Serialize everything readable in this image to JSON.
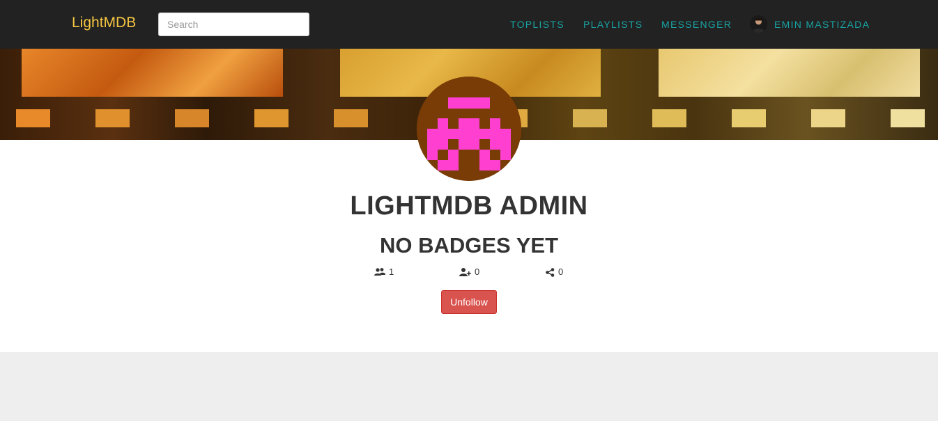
{
  "navbar": {
    "brand": "LightMDB",
    "search_placeholder": "Search",
    "links": [
      "TOPLISTS",
      "PLAYLISTS",
      "MESSENGER"
    ],
    "user_name": "EMIN MASTIZADA"
  },
  "profile": {
    "name": "LIGHTMDB ADMIN",
    "badges_text": "NO BADGES YET",
    "followers_count": "1",
    "following_count": "0",
    "shares_count": "0",
    "unfollow_label": "Unfollow"
  },
  "colors": {
    "navbar_bg": "#222222",
    "brand": "#f4c542",
    "nav_link": "#1aa3a3",
    "unfollow_btn": "#d9534f",
    "avatar_bg": "#7a3c06",
    "avatar_fg": "#ff3fd0"
  },
  "icons": {
    "followers": "users-icon",
    "following": "user-plus-icon",
    "shares": "share-icon"
  }
}
